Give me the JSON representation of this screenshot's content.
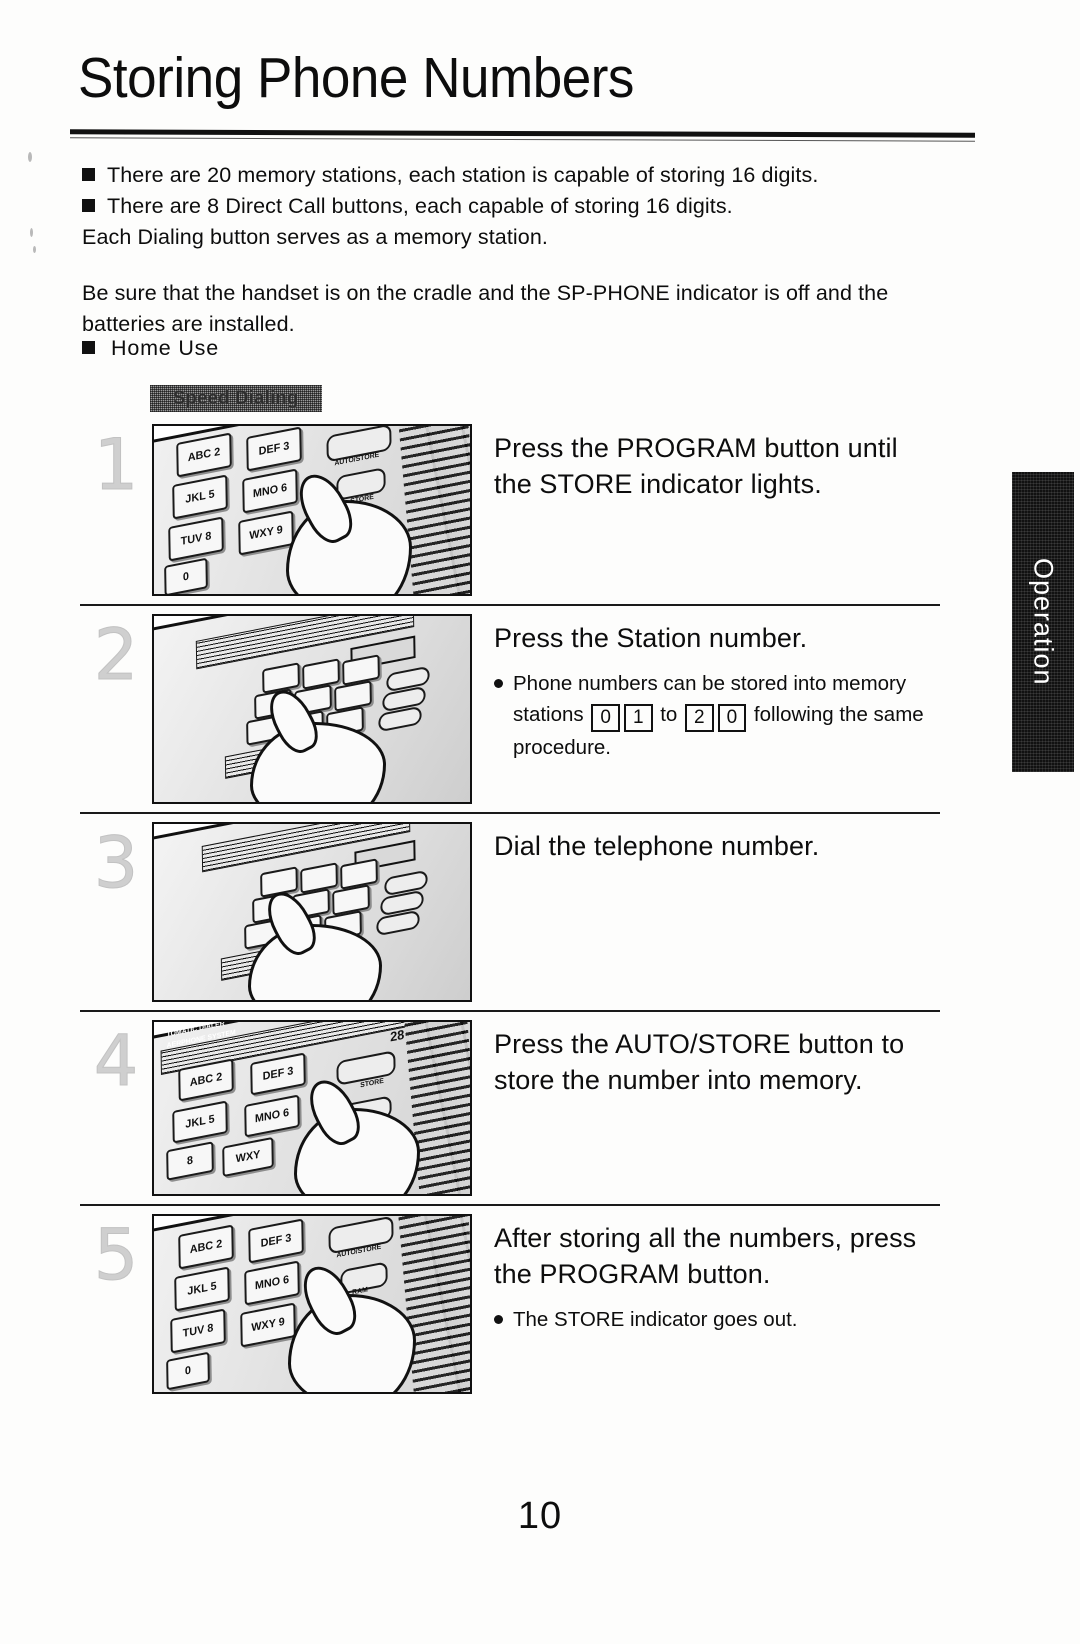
{
  "document": {
    "title": "Storing Phone Numbers",
    "page_number": "10",
    "side_tab_label": "Operation"
  },
  "intro": {
    "bullets": [
      "There are 20 memory stations, each station is capable of storing 16 digits.",
      "There are 8 Direct Call buttons, each capable of storing 16 digits."
    ],
    "plain_line": "Each Dialing button serves as a memory station.",
    "paragraph": "Be sure that the handset is on the cradle and the SP-PHONE indicator is off and the batteries are installed.",
    "section_bullet": "Home Use",
    "section_label": "Speed Dialing"
  },
  "steps": [
    {
      "number": "1",
      "heading": "Press the PROGRAM button until the STORE indicator lights.",
      "sub": null,
      "image_alt": "hand pressing PROGRAM button on phone keypad"
    },
    {
      "number": "2",
      "heading": "Press the Station number.",
      "sub": {
        "before": "Phone numbers can be stored into memory stations",
        "keys_from": [
          "0",
          "1"
        ],
        "to": "to",
        "keys_to": [
          "2",
          "0"
        ],
        "after": "following the same procedure."
      },
      "image_alt": "hand pressing station number key on phone keypad"
    },
    {
      "number": "3",
      "heading": "Dial the telephone number.",
      "sub": null,
      "image_alt": "hand dialing telephone number on phone keypad"
    },
    {
      "number": "4",
      "heading": "Press the AUTO/STORE button to store the number into memory.",
      "sub": null,
      "image_alt": "hand pressing AUTO/STORE button on phone"
    },
    {
      "number": "5",
      "heading": "After storing all the numbers, press the PROGRAM button.",
      "sub": {
        "before": "The STORE indicator goes out.",
        "keys_from": [],
        "to": "",
        "keys_to": [],
        "after": ""
      },
      "image_alt": "hand pressing PROGRAM button on phone keypad"
    }
  ],
  "phone_labels": {
    "auto_store": "AUTO/STORE",
    "store": "STORE",
    "program": "RAM",
    "keys": [
      "ABC 2",
      "DEF 3",
      "JKL 5",
      "MNO 6",
      "TUV 8",
      "WXY 9",
      "0"
    ],
    "system": "TOMATIC DIALER",
    "system2": "AERPHONE SYSTEM",
    "model": "28"
  }
}
